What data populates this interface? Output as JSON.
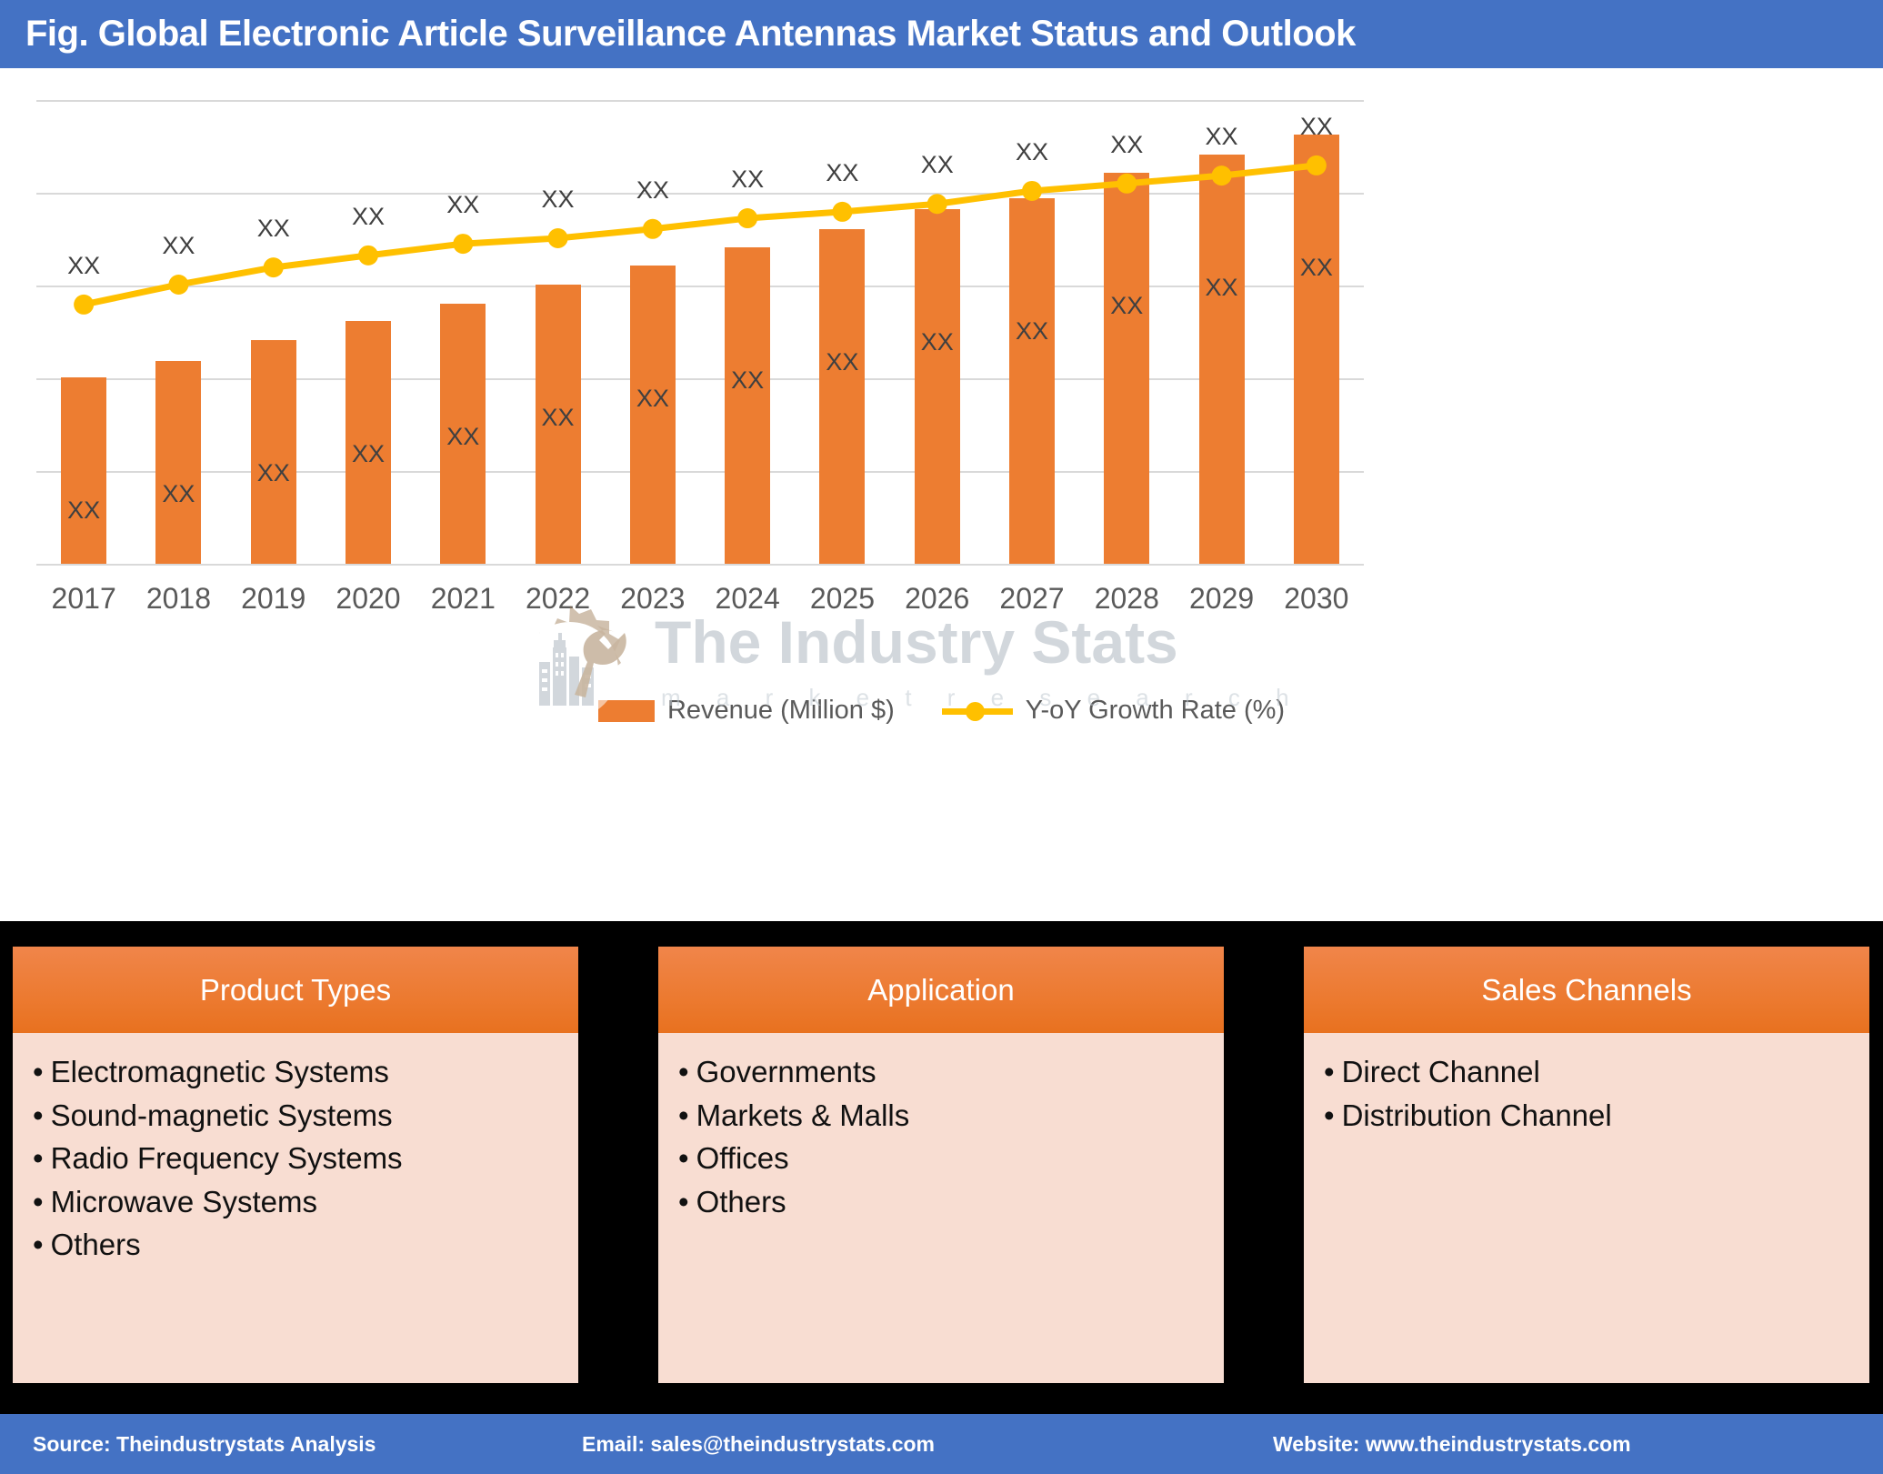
{
  "header": {
    "title": "Fig. Global Electronic Article Surveillance Antennas Market Status and Outlook"
  },
  "colors": {
    "header_blue": "#4472C4",
    "bar_orange": "#ED7D31",
    "line_yellow": "#FFC000",
    "box_head_orange": "#E8711F",
    "box_body_pink": "#F8DDD2",
    "gridline_gray": "#D9D9D9",
    "label_gray": "#404040"
  },
  "chart_data": {
    "type": "bar",
    "title": "Fig. Global Electronic Article Surveillance Antennas Market Status and Outlook",
    "xlabel": "",
    "ylabel": "",
    "grid": true,
    "legend_position": "bottom",
    "categories": [
      "2017",
      "2018",
      "2019",
      "2020",
      "2021",
      "2022",
      "2023",
      "2024",
      "2025",
      "2026",
      "2027",
      "2028",
      "2029",
      "2030"
    ],
    "series": [
      {
        "name": "Revenue (Million $)",
        "type": "bar",
        "color": "#ED7D31",
        "value_labels": [
          "XX",
          "XX",
          "XX",
          "XX",
          "XX",
          "XX",
          "XX",
          "XX",
          "XX",
          "XX",
          "XX",
          "XX",
          "XX",
          "XX"
        ],
        "values": [
          40.2,
          43.7,
          48.2,
          52.4,
          56.1,
          60.2,
          64.3,
          68.2,
          72.2,
          76.5,
          78.8,
          84.3,
          88.2,
          92.5
        ]
      },
      {
        "name": "Y-oY Growth Rate (%)",
        "type": "line",
        "color": "#FFC000",
        "value_labels": [
          "XX",
          "XX",
          "XX",
          "XX",
          "XX",
          "XX",
          "XX",
          "XX",
          "XX",
          "XX",
          "XX",
          "XX",
          "XX",
          "XX"
        ],
        "values": [
          55.9,
          60.2,
          63.9,
          66.5,
          69.0,
          70.2,
          72.2,
          74.5,
          75.9,
          77.6,
          80.4,
          82.0,
          83.7,
          85.9
        ]
      }
    ],
    "ylim": [
      0,
      100
    ],
    "gridline_count": 6
  },
  "legend": {
    "items": [
      {
        "label": "Revenue (Million $)",
        "marker": "square-swatch"
      },
      {
        "label": "Y-oY Growth Rate (%)",
        "marker": "line-with-dot"
      }
    ]
  },
  "watermark": {
    "text": "The Industry Stats",
    "subtext": "m a r k e t    r e s e a r c h",
    "logo_icon": "gear-wrench-buildings-icon"
  },
  "boxes": [
    {
      "title": "Product Types",
      "items": [
        "Electromagnetic Systems",
        "Sound-magnetic Systems",
        "Radio Frequency Systems",
        "Microwave Systems",
        "Others"
      ]
    },
    {
      "title": "Application",
      "items": [
        "Governments",
        "Markets & Malls",
        "Offices",
        "Others"
      ]
    },
    {
      "title": "Sales Channels",
      "items": [
        "Direct Channel",
        "Distribution Channel"
      ]
    }
  ],
  "footer": {
    "source": "Source: Theindustrystats Analysis",
    "email": "Email: sales@theindustrystats.com",
    "website": "Website: www.theindustrystats.com"
  }
}
